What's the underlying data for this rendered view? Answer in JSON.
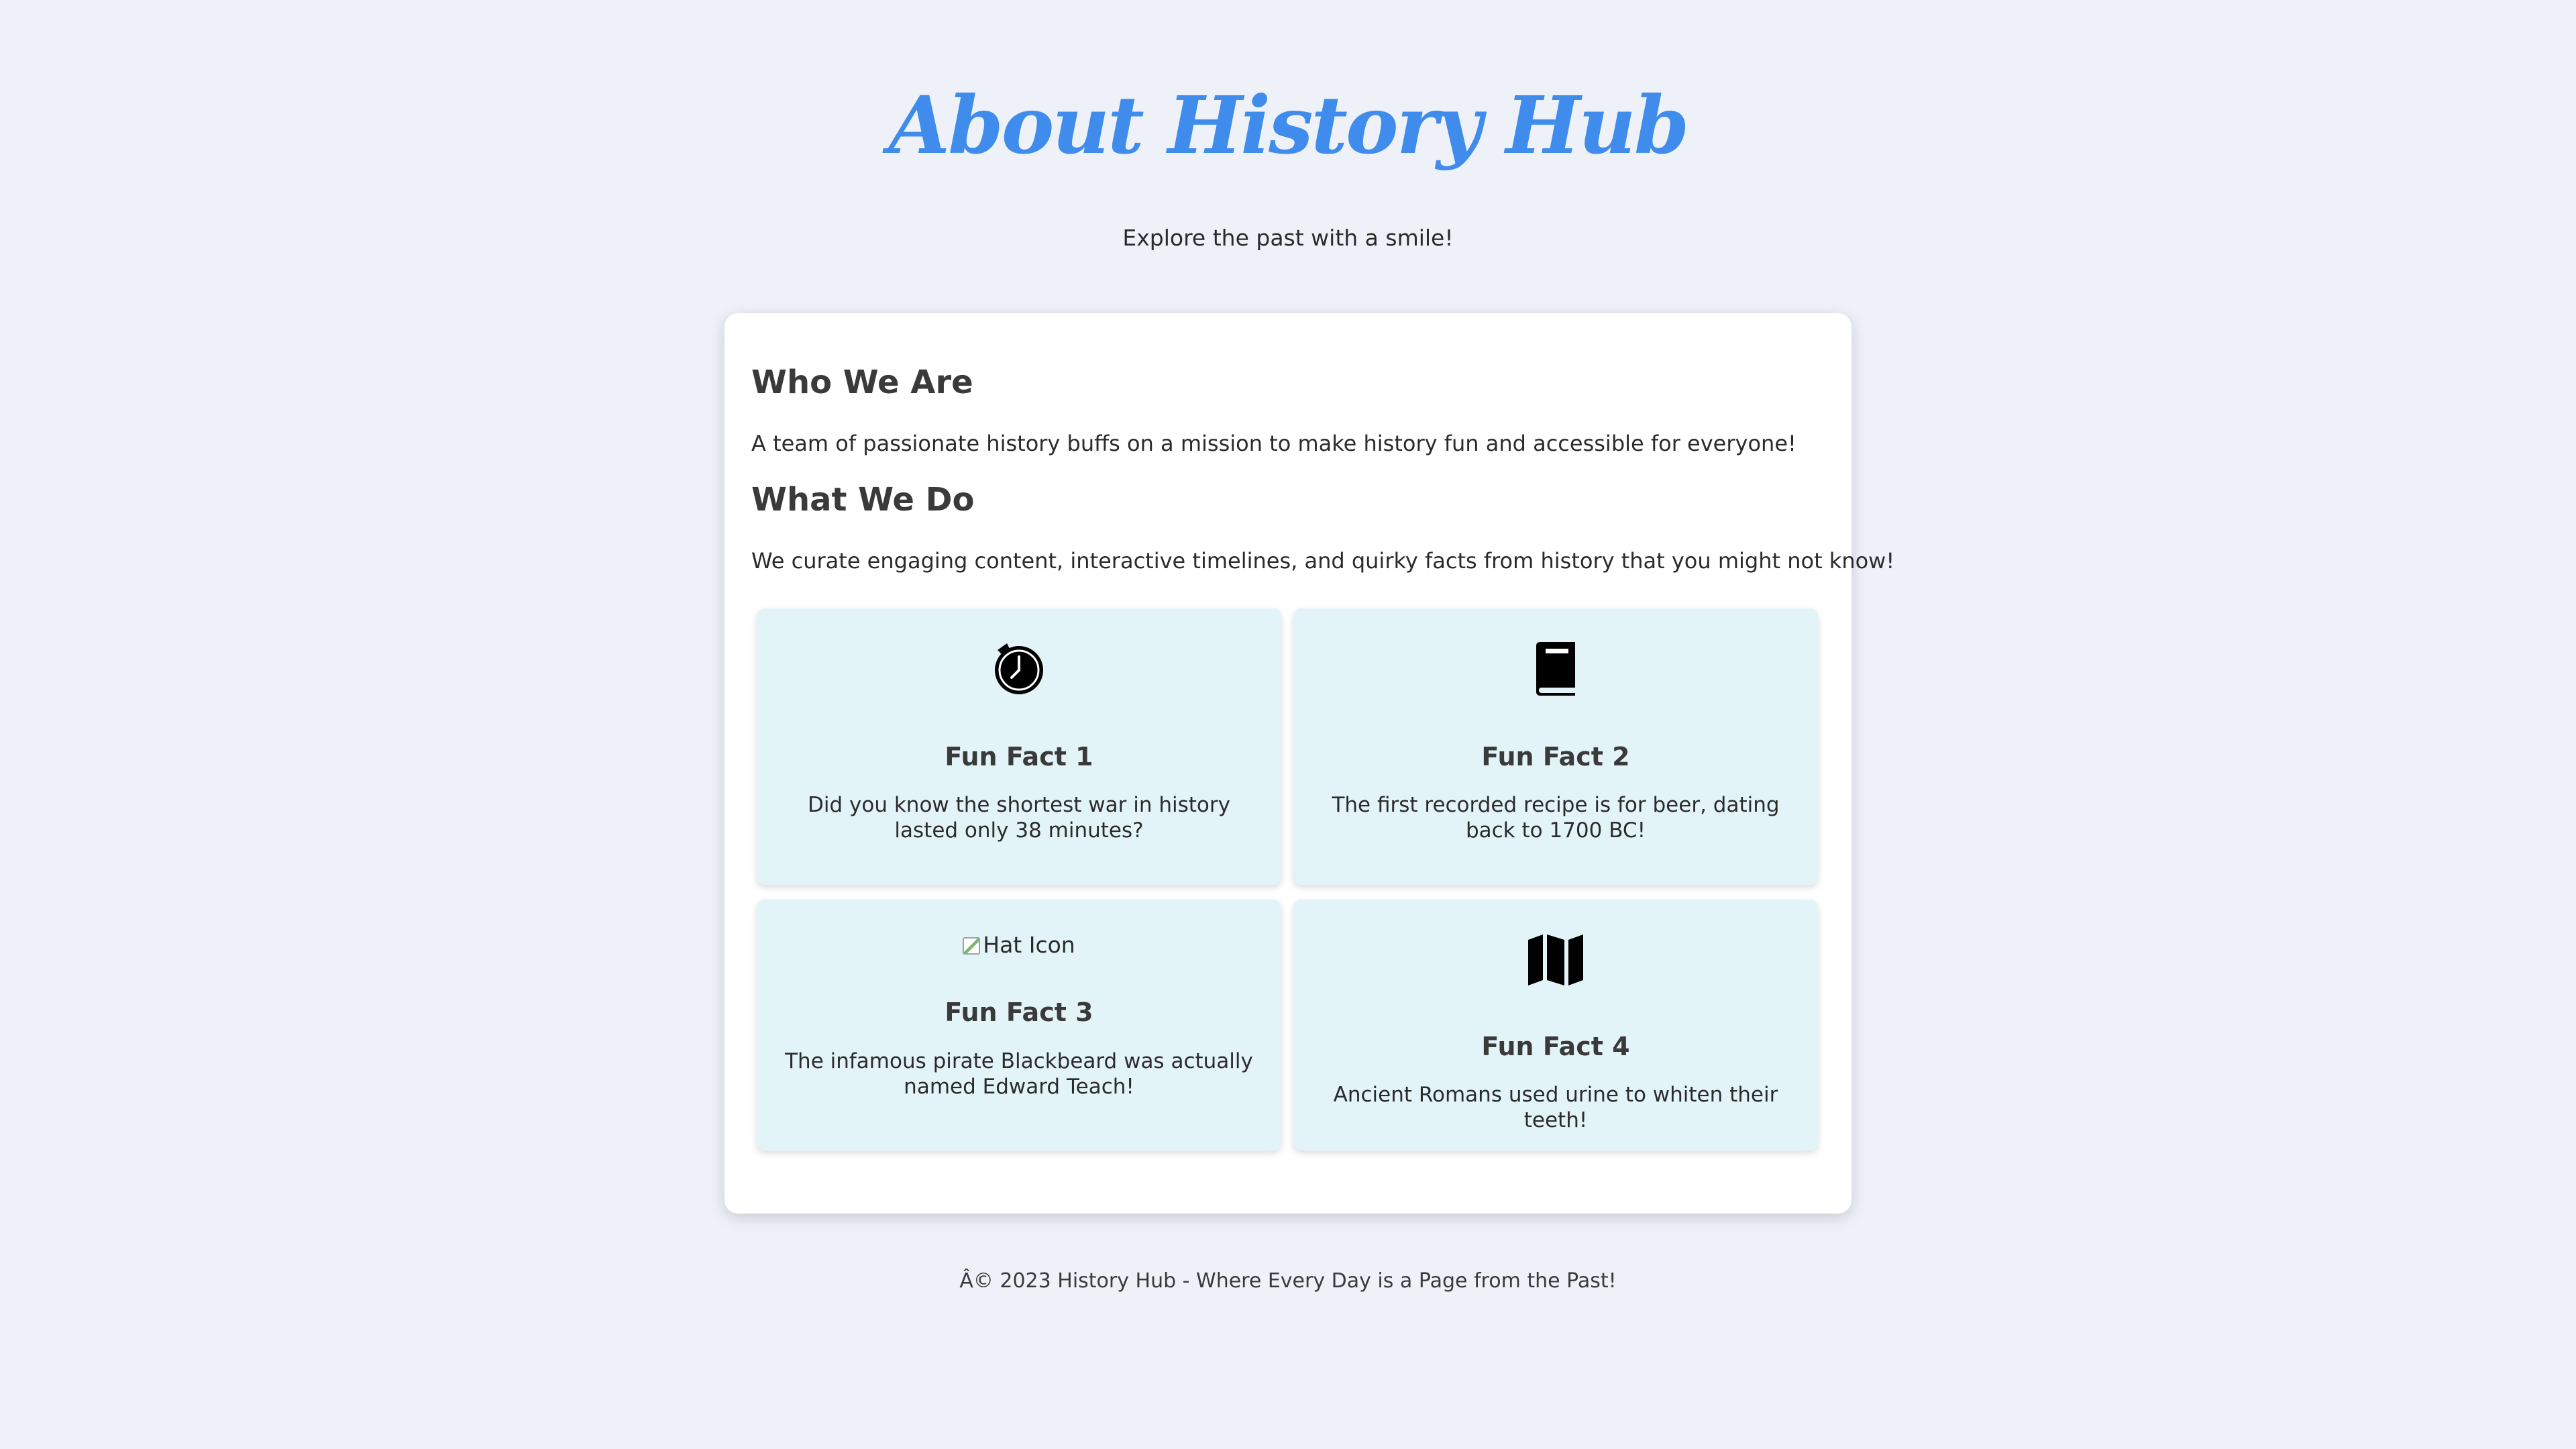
{
  "header": {
    "title": "About History Hub",
    "tagline": "Explore the past with a smile!"
  },
  "about": {
    "who_heading": "Who We Are",
    "who_text": "A team of passionate history buffs on a mission to make history fun and accessible for everyone!",
    "what_heading": "What We Do",
    "what_text": "We curate engaging content, interactive timelines, and quirky facts from history that you might not know!"
  },
  "facts": [
    {
      "icon": "stopwatch-icon",
      "title": "Fun Fact 1",
      "text": "Did you know the shortest war in history lasted only 38 minutes?"
    },
    {
      "icon": "book-icon",
      "title": "Fun Fact 2",
      "text": "The first recorded recipe is for beer, dating back to 1700 BC!"
    },
    {
      "icon": "hat-icon",
      "icon_alt": "Hat Icon",
      "title": "Fun Fact 3",
      "text": "The infamous pirate Blackbeard was actually named Edward Teach!"
    },
    {
      "icon": "map-icon",
      "title": "Fun Fact 4",
      "text": "Ancient Romans used urine to whiten their teeth!"
    }
  ],
  "footer": {
    "text": "Â© 2023 History Hub - Where Every Day is a Page from the Past!"
  },
  "colors": {
    "background": "#eef2f8",
    "title": "#3f8cec",
    "card": "#ffffff",
    "fact_card": "#e3f4f9",
    "text": "#2b2b2b"
  }
}
